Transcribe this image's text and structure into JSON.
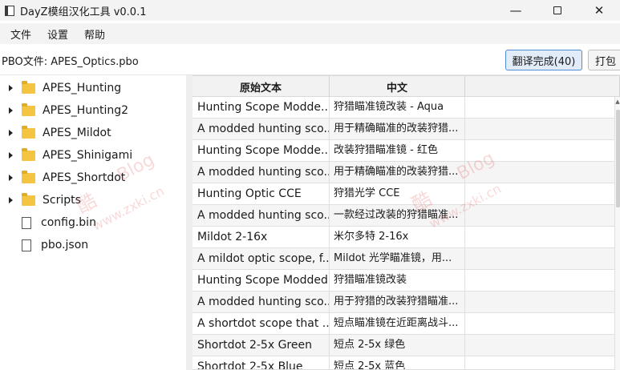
{
  "window": {
    "title": "DayZ模组汉化工具 v0.0.1",
    "minimize_glyph": "—",
    "close_glyph": "✕"
  },
  "menu": [
    "文件",
    "设置",
    "帮助"
  ],
  "toolbar": {
    "pbo_label": "PBO文件: APES_Optics.pbo",
    "translate_button": "翻译完成(40)",
    "pack_button": "打包"
  },
  "tree": {
    "folders": [
      "APES_Hunting",
      "APES_Hunting2",
      "APES_Mildot",
      "APES_Shinigami",
      "APES_Shortdot",
      "Scripts"
    ],
    "files": [
      "config.bin",
      "pbo.json"
    ]
  },
  "table": {
    "headers": [
      "原始文本",
      "中文"
    ],
    "rows": [
      {
        "original": "Hunting Scope Modde...",
        "chinese": "狩猎瞄准镜改装 - Aqua"
      },
      {
        "original": "A modded hunting sco...",
        "chinese": "用于精确瞄准的改装狩猎..."
      },
      {
        "original": "Hunting Scope Modde...",
        "chinese": "改装狩猎瞄准镜 - 红色"
      },
      {
        "original": "A modded hunting sco...",
        "chinese": "用于精确瞄准的改装狩猎..."
      },
      {
        "original": "Hunting Optic CCE",
        "chinese": "狩猎光学 CCE"
      },
      {
        "original": "A modded hunting sco...",
        "chinese": "一款经过改装的狩猎瞄准..."
      },
      {
        "original": "Mildot 2-16x",
        "chinese": "米尔多特 2-16x"
      },
      {
        "original": "A mildot optic scope, f...",
        "chinese": "Mildot 光学瞄准镜，用..."
      },
      {
        "original": "Hunting Scope Modded",
        "chinese": "狩猎瞄准镜改装"
      },
      {
        "original": "A modded hunting sco...",
        "chinese": "用于狩猎的改装狩猎瞄准..."
      },
      {
        "original": "A shortdot scope that ...",
        "chinese": "短点瞄准镜在近距离战斗..."
      },
      {
        "original": "Shortdot 2-5x Green",
        "chinese": "短点 2-5x 绿色"
      },
      {
        "original": "Shortdot 2-5x Blue",
        "chinese": "短点 2-5x 蓝色"
      }
    ]
  },
  "watermarks": [
    "酷",
    "Blog",
    "www.zxki.cn",
    "酷",
    "Blog",
    "www.zxki.cn"
  ],
  "colors": {
    "accent_border": "#4f8cd6",
    "accent_fill": "#e1ecf8",
    "folder": "#f5c541",
    "watermark": "#e25757"
  }
}
